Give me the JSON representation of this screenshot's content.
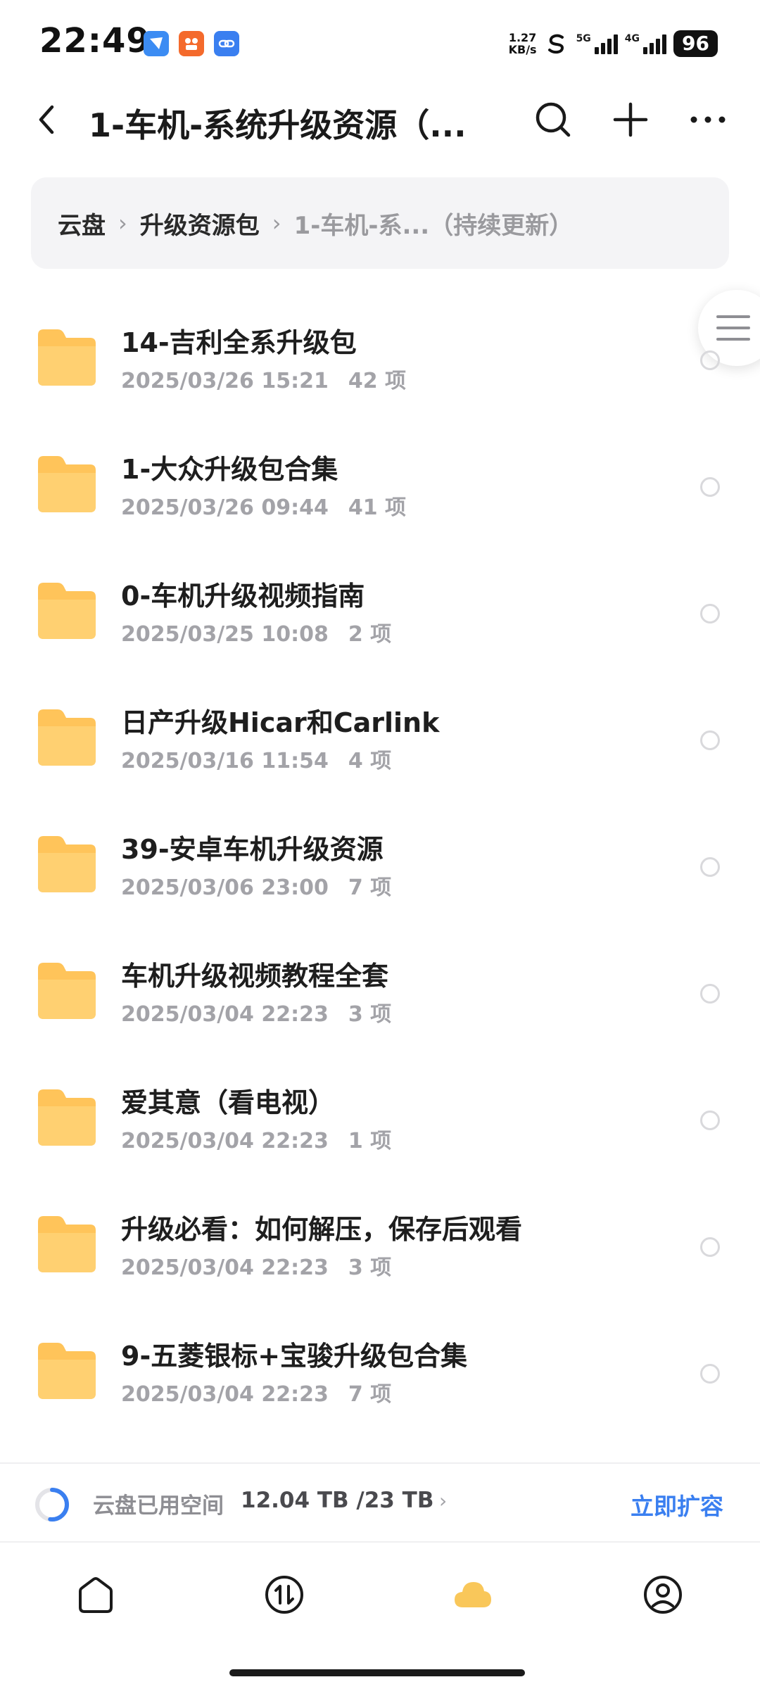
{
  "status_bar": {
    "time": "22:49",
    "net_speed_value": "1.27",
    "net_speed_unit": "KB/s",
    "signal_5g_label": "5G",
    "signal_4g_label": "4G",
    "battery": "96",
    "notification_icons": [
      "feishu-icon",
      "tiktok-store-icon",
      "link-icon"
    ]
  },
  "header": {
    "title": "1-车机-系统升级资源（...",
    "icons": [
      "back-icon",
      "search-icon",
      "add-icon",
      "more-icon"
    ]
  },
  "breadcrumb": {
    "items": [
      "云盘",
      "升级资源包",
      "1-车机-系...（持续更新）"
    ]
  },
  "files": [
    {
      "name": "14-吉利全系升级包",
      "date": "2025/03/26 15:21",
      "count": "42 项"
    },
    {
      "name": "1-大众升级包合集",
      "date": "2025/03/26 09:44",
      "count": "41 项"
    },
    {
      "name": "0-车机升级视频指南",
      "date": "2025/03/25 10:08",
      "count": "2 项"
    },
    {
      "name": "日产升级Hicar和Carlink",
      "date": "2025/03/16 11:54",
      "count": "4 项"
    },
    {
      "name": "39-安卓车机升级资源",
      "date": "2025/03/06 23:00",
      "count": "7 项"
    },
    {
      "name": "车机升级视频教程全套",
      "date": "2025/03/04 22:23",
      "count": "3 项"
    },
    {
      "name": "爱其意（看电视）",
      "date": "2025/03/04 22:23",
      "count": "1 项"
    },
    {
      "name": "升级必看：如何解压，保存后观看",
      "date": "2025/03/04 22:23",
      "count": "3 项"
    },
    {
      "name": "9-五菱银标+宝骏升级包合集",
      "date": "2025/03/04 22:23",
      "count": "7 项"
    }
  ],
  "storage": {
    "label": "云盘已用空间",
    "value": "12.04 TB /23 TB",
    "expand_label": "立即扩容",
    "used_fraction": 0.52
  },
  "bottom_nav": {
    "items": [
      "home-icon",
      "transfer-icon",
      "cloud-icon",
      "profile-icon"
    ],
    "active": "cloud-icon"
  },
  "colors": {
    "accent": "#3a7ff0",
    "folder": "#ffc45a",
    "cloud_active": "#f9c75a"
  }
}
